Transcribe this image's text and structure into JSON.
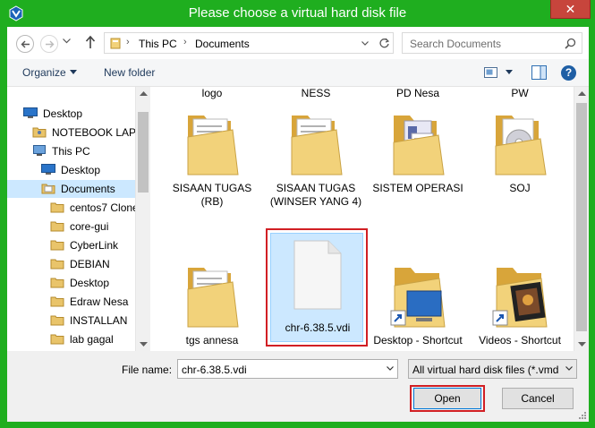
{
  "window": {
    "title": "Please choose a virtual hard disk file",
    "close_glyph": "✕"
  },
  "nav": {
    "breadcrumbs": [
      "This PC",
      "Documents"
    ],
    "search_placeholder": "Search Documents"
  },
  "toolbar": {
    "organize_label": "Organize",
    "new_folder_label": "New folder",
    "help_glyph": "?"
  },
  "tree": [
    {
      "label": "Desktop",
      "icon": "desktop-icon"
    },
    {
      "label": "NOTEBOOK LAPT",
      "icon": "user-folder-icon"
    },
    {
      "label": "This PC",
      "icon": "computer-icon"
    },
    {
      "label": "Desktop",
      "icon": "desktop-folder-icon"
    },
    {
      "label": "Documents",
      "icon": "documents-icon",
      "selected": true
    },
    {
      "label": "centos7 Clone",
      "icon": "folder-icon"
    },
    {
      "label": "core-gui",
      "icon": "folder-icon"
    },
    {
      "label": "CyberLink",
      "icon": "folder-icon"
    },
    {
      "label": "DEBIAN",
      "icon": "folder-icon"
    },
    {
      "label": "Desktop",
      "icon": "folder-icon"
    },
    {
      "label": "Edraw Nesa",
      "icon": "folder-icon"
    },
    {
      "label": "INSTALLAN",
      "icon": "folder-icon"
    },
    {
      "label": "lab gagal",
      "icon": "folder-icon"
    }
  ],
  "files": {
    "top_row_labels": [
      "logo",
      "NESS",
      "PD Nesa",
      "PW"
    ],
    "row1": [
      {
        "label": "SISAAN TUGAS (RB)",
        "kind": "folder-with-documents"
      },
      {
        "label": "SISAAN TUGAS (WINSER YANG 4)",
        "kind": "folder-with-documents"
      },
      {
        "label": "SISTEM OPERASI",
        "kind": "folder-with-pages"
      },
      {
        "label": "SOJ",
        "kind": "folder-with-disc"
      }
    ],
    "row2": [
      {
        "label": "tgs annesa",
        "kind": "folder-with-documents"
      },
      {
        "label": "chr-6.38.5.vdi",
        "kind": "blank-file",
        "selected": true
      },
      {
        "label": "Desktop - Shortcut",
        "kind": "folder-shortcut-desktop"
      },
      {
        "label": "Videos - Shortcut",
        "kind": "folder-shortcut-videos"
      }
    ]
  },
  "bottom": {
    "file_name_label": "File name:",
    "file_name_value": "chr-6.38.5.vdi",
    "file_type_value": "All virtual hard disk files (*.vmd",
    "open_label": "Open",
    "cancel_label": "Cancel"
  },
  "colors": {
    "title_bar": "#1fae1f",
    "close_button": "#c7453c",
    "selection_fill": "#cce8ff",
    "highlight_outline": "#d11f24"
  }
}
